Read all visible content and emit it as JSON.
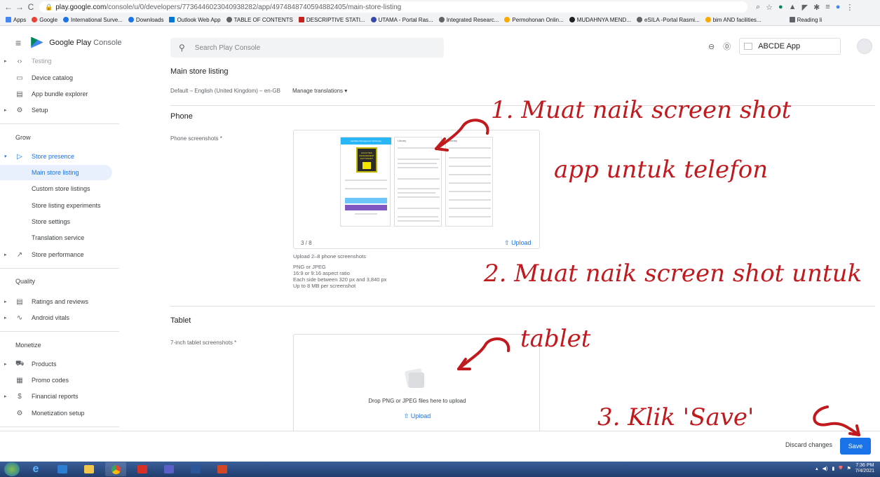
{
  "browser": {
    "url_host": "play.google.com",
    "url_path": "/console/u/0/developers/7736446023040938282/app/4974848740594882405/main-store-listing",
    "bookmarks": [
      "Apps",
      "Google",
      "International Surve...",
      "Downloads",
      "Outlook Web App",
      "TABLE OF CONTENTS",
      "DESCRIPTIVE STATI...",
      "UTAMA - Portal Ras...",
      "Integrated Researc...",
      "Permohonan Onlin...",
      "MUDAHNYA MEND...",
      "eSILA -Portal Rasmi...",
      "bim AND facilities...",
      "Reading li"
    ]
  },
  "header": {
    "product_name": "Google Play",
    "product_suffix": "Console",
    "search_placeholder": "Search Play Console",
    "app_name": "ABCDE App"
  },
  "sidebar": {
    "top_partial": "Testing",
    "items_a": [
      "Device catalog",
      "App bundle explorer",
      "Setup"
    ],
    "grow_label": "Grow",
    "store_presence": "Store presence",
    "store_sub": [
      "Main store listing",
      "Custom store listings",
      "Store listing experiments",
      "Store settings",
      "Translation service"
    ],
    "store_performance": "Store performance",
    "quality_label": "Quality",
    "quality_items": [
      "Ratings and reviews",
      "Android vitals"
    ],
    "monetize_label": "Monetize",
    "monetize_items": [
      "Products",
      "Promo codes",
      "Financial reports",
      "Monetization setup"
    ]
  },
  "main": {
    "title": "Main store listing",
    "language": "Default – English (United Kingdom) – en-GB",
    "manage_translations": "Manage translations",
    "phone_heading": "Phone",
    "phone_label": "Phone screenshots",
    "phone_counter": "3 / 8",
    "upload_label": "Upload",
    "phone_help": [
      "Upload 2–8 phone screenshots",
      "PNG or JPEG",
      "16:9 or 9:16 aspect ratio",
      "Each side between 320 px and 3,840 px",
      "Up to 8 MB per screenshot"
    ],
    "tablet_heading": "Tablet",
    "tablet_label": "7-inch tablet screenshots",
    "tablet_drop": "Drop PNG or JPEG files here to upload",
    "required_mark": "*"
  },
  "shots": {
    "shot1_title": "Facilities Management Dictionary",
    "shot1_book": "FACILITIES MANAGEMENT DICTIONARY",
    "shot2_title": "Library",
    "shot3_title": "Library"
  },
  "footer": {
    "discard": "Discard changes",
    "save": "Save"
  },
  "taskbar": {
    "time": "7:36 PM",
    "date": "7/4/2021"
  },
  "annotations": {
    "a1_line1": "1. Muat naik screen shot",
    "a1_line2": "app untuk telefon",
    "a2": "2. Muat naik screen shot untuk",
    "a2_cont": "tablet",
    "a3": "3. Klik 'Save'"
  },
  "colors": {
    "accent": "#1a73e8",
    "annotation": "#c0191e",
    "brand_green": "#01875f"
  }
}
